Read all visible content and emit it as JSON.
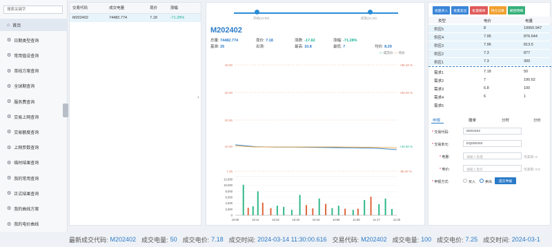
{
  "sidebar": {
    "search_placeholder": "搜索关键字",
    "items": [
      {
        "label": "首页",
        "active": true
      },
      {
        "label": "日期类型查询"
      },
      {
        "label": "常用值设查询"
      },
      {
        "label": "单线方案查询"
      },
      {
        "label": "全球期查询"
      },
      {
        "label": "服务费查询"
      },
      {
        "label": "交易上网查询"
      },
      {
        "label": "交易额度查询"
      },
      {
        "label": "上网参数查询"
      },
      {
        "label": "临时结果查询"
      },
      {
        "label": "我的常用查询"
      },
      {
        "label": "正式结果查询"
      },
      {
        "label": "我的曲线方案"
      },
      {
        "label": "我的电价曲线"
      }
    ]
  },
  "orders": {
    "headers": [
      "交易代码",
      "成交电量",
      "现价",
      "涨幅"
    ],
    "rows": [
      [
        "M202402",
        "74482.774",
        "7.18",
        "-71.28%"
      ]
    ]
  },
  "center": {
    "slider_left": "开始(10:00)",
    "slider_right": "结束(11:30)",
    "code": "M202402",
    "labels": {
      "total": "总量:",
      "base": "基准:",
      "price": "现价:",
      "open": "出清:",
      "change": "涨跌:",
      "high": "最高:",
      "pct": "涨幅:",
      "low": "最低:",
      "avg": "均价:"
    },
    "values": {
      "total": "74482.774",
      "base": "25",
      "price": "7.18",
      "open": "",
      "change": "-17.82",
      "high": "10.8",
      "pct": "-71.28%",
      "low": "7",
      "avg": "8.29"
    },
    "legend": [
      "成交价",
      "均价"
    ]
  },
  "chart_data": {
    "type": "line",
    "x": [
      "10:00",
      "10:11",
      "10:22",
      "10:33",
      "10:44",
      "10:55",
      "11:06",
      "11:17",
      "11:30"
    ],
    "title": "",
    "y_ticks": [
      "40.00",
      "30.00",
      "20.00",
      "10.00",
      "7.46"
    ],
    "y_pct_ticks": [
      "+98.40 %",
      "+60.20 %",
      "",
      "+40.20 %",
      "-98.40 %"
    ],
    "series": [
      {
        "name": "成交价",
        "values": [
          10.5,
          9.6,
          9.4,
          9.4,
          9.3,
          9.2,
          9.1,
          8.9,
          8.3
        ]
      },
      {
        "name": "均价",
        "values": [
          10.0,
          9.5,
          9.5,
          9.5,
          9.5,
          9.5,
          9.4,
          9.3,
          9.1
        ]
      }
    ],
    "ylim": [
      0,
      46
    ],
    "volume": {
      "y_ticks": [
        "12,000",
        "10,000",
        "8,000",
        "6,000",
        "4,000",
        "2,000",
        "0"
      ],
      "ylim": [
        0,
        12000
      ],
      "bars": [
        {
          "t": 0.05,
          "v": 10200,
          "c": "green"
        },
        {
          "t": 0.08,
          "v": 2500,
          "c": "red"
        },
        {
          "t": 0.11,
          "v": 3000,
          "c": "green"
        },
        {
          "t": 0.14,
          "v": 8000,
          "c": "green"
        },
        {
          "t": 0.17,
          "v": 4200,
          "c": "red"
        },
        {
          "t": 0.22,
          "v": 2400,
          "c": "red"
        },
        {
          "t": 0.26,
          "v": 3200,
          "c": "green"
        },
        {
          "t": 0.3,
          "v": 2800,
          "c": "green"
        },
        {
          "t": 0.35,
          "v": 1800,
          "c": "green"
        },
        {
          "t": 0.4,
          "v": 6800,
          "c": "green"
        },
        {
          "t": 0.44,
          "v": 3400,
          "c": "red"
        },
        {
          "t": 0.48,
          "v": 2300,
          "c": "red"
        },
        {
          "t": 0.52,
          "v": 5600,
          "c": "green"
        },
        {
          "t": 0.56,
          "v": 3800,
          "c": "red"
        },
        {
          "t": 0.6,
          "v": 2400,
          "c": "green"
        },
        {
          "t": 0.64,
          "v": 3200,
          "c": "green"
        },
        {
          "t": 0.68,
          "v": 2200,
          "c": "red"
        },
        {
          "t": 0.73,
          "v": 1800,
          "c": "green"
        },
        {
          "t": 0.76,
          "v": 2200,
          "c": "red"
        },
        {
          "t": 0.8,
          "v": 5100,
          "c": "green"
        },
        {
          "t": 0.84,
          "v": 6200,
          "c": "red"
        },
        {
          "t": 0.89,
          "v": 3700,
          "c": "green"
        },
        {
          "t": 0.93,
          "v": 5600,
          "c": "green"
        },
        {
          "t": 0.97,
          "v": 2100,
          "c": "green"
        }
      ]
    }
  },
  "right": {
    "buttons": [
      {
        "label": "批量买入",
        "color": "#3a85d8"
      },
      {
        "label": "批量卖出",
        "color": "#3a85d8"
      },
      {
        "label": "批量撤单",
        "color": "#e05a5a"
      },
      {
        "label": "持仓记录",
        "color": "#f0a030"
      },
      {
        "label": "撤回明细",
        "color": "#36b07a"
      }
    ],
    "depth_headers": [
      "类型",
      "电价",
      "电量"
    ],
    "sells": [
      {
        "type": "供应5",
        "price": "8",
        "qty": "19950.947"
      },
      {
        "type": "供应4",
        "price": "7.95",
        "qty": "876.644"
      },
      {
        "type": "供应3",
        "price": "7.96",
        "qty": "813.5"
      },
      {
        "type": "供应2",
        "price": "7.3",
        "qty": "877"
      },
      {
        "type": "供应1",
        "price": "7.3",
        "qty": "300"
      }
    ],
    "buys": [
      {
        "type": "需求1",
        "price": "7.18",
        "qty": "50"
      },
      {
        "type": "需求2",
        "price": "7",
        "qty": "190.62"
      },
      {
        "type": "需求3",
        "price": "6.8",
        "qty": "100"
      },
      {
        "type": "需求4",
        "price": "6",
        "qty": "1"
      },
      {
        "type": "需求5",
        "price": "",
        "qty": ""
      }
    ],
    "tabs": [
      "申报",
      "撤单",
      "分时",
      "分价"
    ],
    "form": {
      "code_label": "交易代码:",
      "code_value": "M202402",
      "unit_label": "交易单元:",
      "unit_value": "DQ000203",
      "qty_label": "电量:",
      "qty_placeholder": "请输入电量",
      "qty_hint": "可卖的: 0",
      "price_label": "电价:",
      "price_placeholder": "请输入电价",
      "price_hint": "可卖的: 0.0",
      "mode_label": "申报方式:",
      "opt_buy": "买入",
      "opt_sell": "卖出",
      "submit": "提交申报"
    }
  },
  "ticker": {
    "segments": [
      {
        "label": "最新成交代码:",
        "value": "M202402"
      },
      {
        "label": "成交电量:",
        "value": "50"
      },
      {
        "label": "成交电价:",
        "value": "7.18"
      },
      {
        "label": "成交时间:",
        "value": "2024-03-14 11:30:00.616"
      },
      {
        "label": "交易代码:",
        "value": "M202402"
      },
      {
        "label": "成交电量:",
        "value": "100"
      },
      {
        "label": "成交电价:",
        "value": "7.25"
      },
      {
        "label": "成交时间:",
        "value": "2024-03-1"
      }
    ]
  }
}
